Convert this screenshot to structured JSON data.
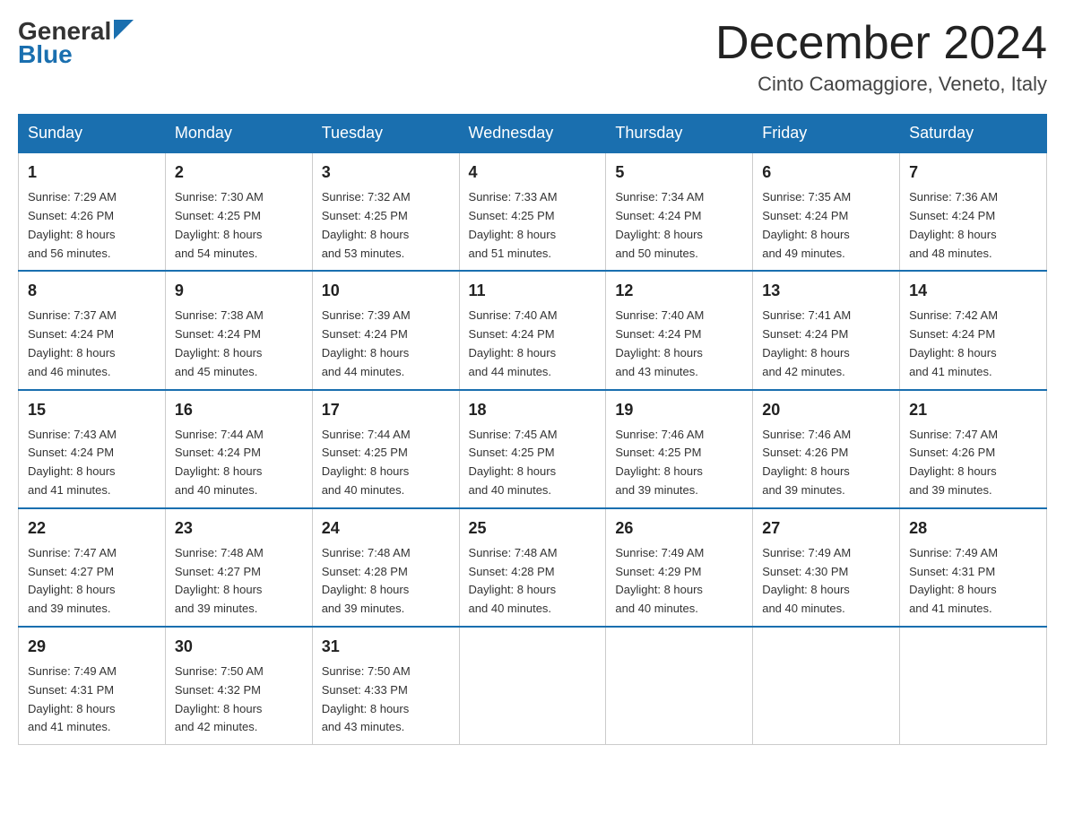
{
  "header": {
    "logo_line1": "General",
    "logo_line2": "Blue",
    "month_title": "December 2024",
    "location": "Cinto Caomaggiore, Veneto, Italy"
  },
  "days_of_week": [
    "Sunday",
    "Monday",
    "Tuesday",
    "Wednesday",
    "Thursday",
    "Friday",
    "Saturday"
  ],
  "weeks": [
    [
      {
        "day": "1",
        "sunrise": "7:29 AM",
        "sunset": "4:26 PM",
        "daylight": "8 hours and 56 minutes."
      },
      {
        "day": "2",
        "sunrise": "7:30 AM",
        "sunset": "4:25 PM",
        "daylight": "8 hours and 54 minutes."
      },
      {
        "day": "3",
        "sunrise": "7:32 AM",
        "sunset": "4:25 PM",
        "daylight": "8 hours and 53 minutes."
      },
      {
        "day": "4",
        "sunrise": "7:33 AM",
        "sunset": "4:25 PM",
        "daylight": "8 hours and 51 minutes."
      },
      {
        "day": "5",
        "sunrise": "7:34 AM",
        "sunset": "4:24 PM",
        "daylight": "8 hours and 50 minutes."
      },
      {
        "day": "6",
        "sunrise": "7:35 AM",
        "sunset": "4:24 PM",
        "daylight": "8 hours and 49 minutes."
      },
      {
        "day": "7",
        "sunrise": "7:36 AM",
        "sunset": "4:24 PM",
        "daylight": "8 hours and 48 minutes."
      }
    ],
    [
      {
        "day": "8",
        "sunrise": "7:37 AM",
        "sunset": "4:24 PM",
        "daylight": "8 hours and 46 minutes."
      },
      {
        "day": "9",
        "sunrise": "7:38 AM",
        "sunset": "4:24 PM",
        "daylight": "8 hours and 45 minutes."
      },
      {
        "day": "10",
        "sunrise": "7:39 AM",
        "sunset": "4:24 PM",
        "daylight": "8 hours and 44 minutes."
      },
      {
        "day": "11",
        "sunrise": "7:40 AM",
        "sunset": "4:24 PM",
        "daylight": "8 hours and 44 minutes."
      },
      {
        "day": "12",
        "sunrise": "7:40 AM",
        "sunset": "4:24 PM",
        "daylight": "8 hours and 43 minutes."
      },
      {
        "day": "13",
        "sunrise": "7:41 AM",
        "sunset": "4:24 PM",
        "daylight": "8 hours and 42 minutes."
      },
      {
        "day": "14",
        "sunrise": "7:42 AM",
        "sunset": "4:24 PM",
        "daylight": "8 hours and 41 minutes."
      }
    ],
    [
      {
        "day": "15",
        "sunrise": "7:43 AM",
        "sunset": "4:24 PM",
        "daylight": "8 hours and 41 minutes."
      },
      {
        "day": "16",
        "sunrise": "7:44 AM",
        "sunset": "4:24 PM",
        "daylight": "8 hours and 40 minutes."
      },
      {
        "day": "17",
        "sunrise": "7:44 AM",
        "sunset": "4:25 PM",
        "daylight": "8 hours and 40 minutes."
      },
      {
        "day": "18",
        "sunrise": "7:45 AM",
        "sunset": "4:25 PM",
        "daylight": "8 hours and 40 minutes."
      },
      {
        "day": "19",
        "sunrise": "7:46 AM",
        "sunset": "4:25 PM",
        "daylight": "8 hours and 39 minutes."
      },
      {
        "day": "20",
        "sunrise": "7:46 AM",
        "sunset": "4:26 PM",
        "daylight": "8 hours and 39 minutes."
      },
      {
        "day": "21",
        "sunrise": "7:47 AM",
        "sunset": "4:26 PM",
        "daylight": "8 hours and 39 minutes."
      }
    ],
    [
      {
        "day": "22",
        "sunrise": "7:47 AM",
        "sunset": "4:27 PM",
        "daylight": "8 hours and 39 minutes."
      },
      {
        "day": "23",
        "sunrise": "7:48 AM",
        "sunset": "4:27 PM",
        "daylight": "8 hours and 39 minutes."
      },
      {
        "day": "24",
        "sunrise": "7:48 AM",
        "sunset": "4:28 PM",
        "daylight": "8 hours and 39 minutes."
      },
      {
        "day": "25",
        "sunrise": "7:48 AM",
        "sunset": "4:28 PM",
        "daylight": "8 hours and 40 minutes."
      },
      {
        "day": "26",
        "sunrise": "7:49 AM",
        "sunset": "4:29 PM",
        "daylight": "8 hours and 40 minutes."
      },
      {
        "day": "27",
        "sunrise": "7:49 AM",
        "sunset": "4:30 PM",
        "daylight": "8 hours and 40 minutes."
      },
      {
        "day": "28",
        "sunrise": "7:49 AM",
        "sunset": "4:31 PM",
        "daylight": "8 hours and 41 minutes."
      }
    ],
    [
      {
        "day": "29",
        "sunrise": "7:49 AM",
        "sunset": "4:31 PM",
        "daylight": "8 hours and 41 minutes."
      },
      {
        "day": "30",
        "sunrise": "7:50 AM",
        "sunset": "4:32 PM",
        "daylight": "8 hours and 42 minutes."
      },
      {
        "day": "31",
        "sunrise": "7:50 AM",
        "sunset": "4:33 PM",
        "daylight": "8 hours and 43 minutes."
      },
      null,
      null,
      null,
      null
    ]
  ],
  "labels": {
    "sunrise": "Sunrise:",
    "sunset": "Sunset:",
    "daylight": "Daylight:"
  }
}
